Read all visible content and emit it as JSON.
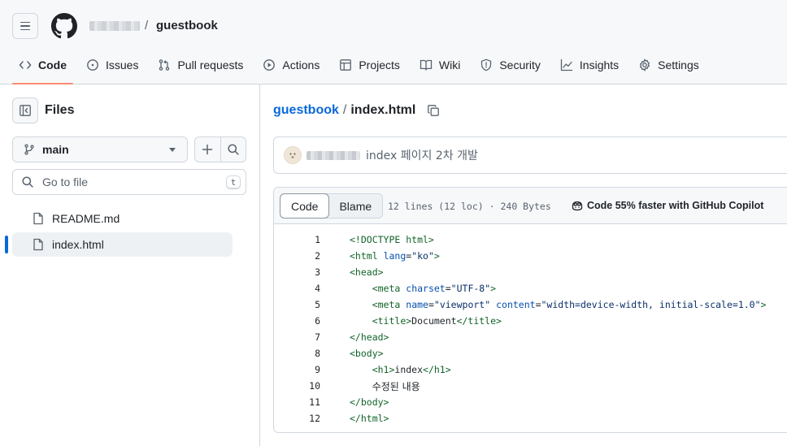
{
  "header": {
    "repo_name": "guestbook",
    "separator": "/"
  },
  "tabs": [
    {
      "label": "Code",
      "icon": "code-icon"
    },
    {
      "label": "Issues",
      "icon": "issue-icon"
    },
    {
      "label": "Pull requests",
      "icon": "pull-request-icon"
    },
    {
      "label": "Actions",
      "icon": "play-icon"
    },
    {
      "label": "Projects",
      "icon": "table-icon"
    },
    {
      "label": "Wiki",
      "icon": "book-icon"
    },
    {
      "label": "Security",
      "icon": "shield-icon"
    },
    {
      "label": "Insights",
      "icon": "graph-icon"
    },
    {
      "label": "Settings",
      "icon": "gear-icon"
    }
  ],
  "sidebar": {
    "title": "Files",
    "branch": "main",
    "search_placeholder": "Go to file",
    "search_shortcut": "t",
    "files": [
      {
        "name": "README.md",
        "active": false
      },
      {
        "name": "index.html",
        "active": true
      }
    ]
  },
  "main": {
    "path_repo": "guestbook",
    "path_sep": "/",
    "path_file": "index.html",
    "commit_message": "index 페이지 2차 개발",
    "view_tabs": [
      "Code",
      "Blame"
    ],
    "file_stats": "12 lines (12 loc) · 240 Bytes",
    "copilot_text": "Code 55% faster with GitHub Copilot",
    "code_lines": [
      {
        "n": "1",
        "indent": 0,
        "text": "<!DOCTYPE html>"
      },
      {
        "n": "2",
        "indent": 0,
        "text": "<html lang=\"ko\">"
      },
      {
        "n": "3",
        "indent": 0,
        "text": "<head>"
      },
      {
        "n": "4",
        "indent": 1,
        "text": "<meta charset=\"UTF-8\">"
      },
      {
        "n": "5",
        "indent": 1,
        "text": "<meta name=\"viewport\" content=\"width=device-width, initial-scale=1.0\">"
      },
      {
        "n": "6",
        "indent": 1,
        "text": "<title>Document</title>"
      },
      {
        "n": "7",
        "indent": 0,
        "text": "</head>"
      },
      {
        "n": "8",
        "indent": 0,
        "text": "<body>"
      },
      {
        "n": "9",
        "indent": 1,
        "text": "<h1>index</h1>"
      },
      {
        "n": "10",
        "indent": 1,
        "text": "수정된 내용"
      },
      {
        "n": "11",
        "indent": 0,
        "text": "</body>"
      },
      {
        "n": "12",
        "indent": 0,
        "text": "</html>"
      }
    ]
  },
  "colors": {
    "link": "#0969da",
    "tab_underline": "#fd8c73",
    "tag": "#116329",
    "attr": "#0550ae",
    "string": "#0a3069"
  }
}
